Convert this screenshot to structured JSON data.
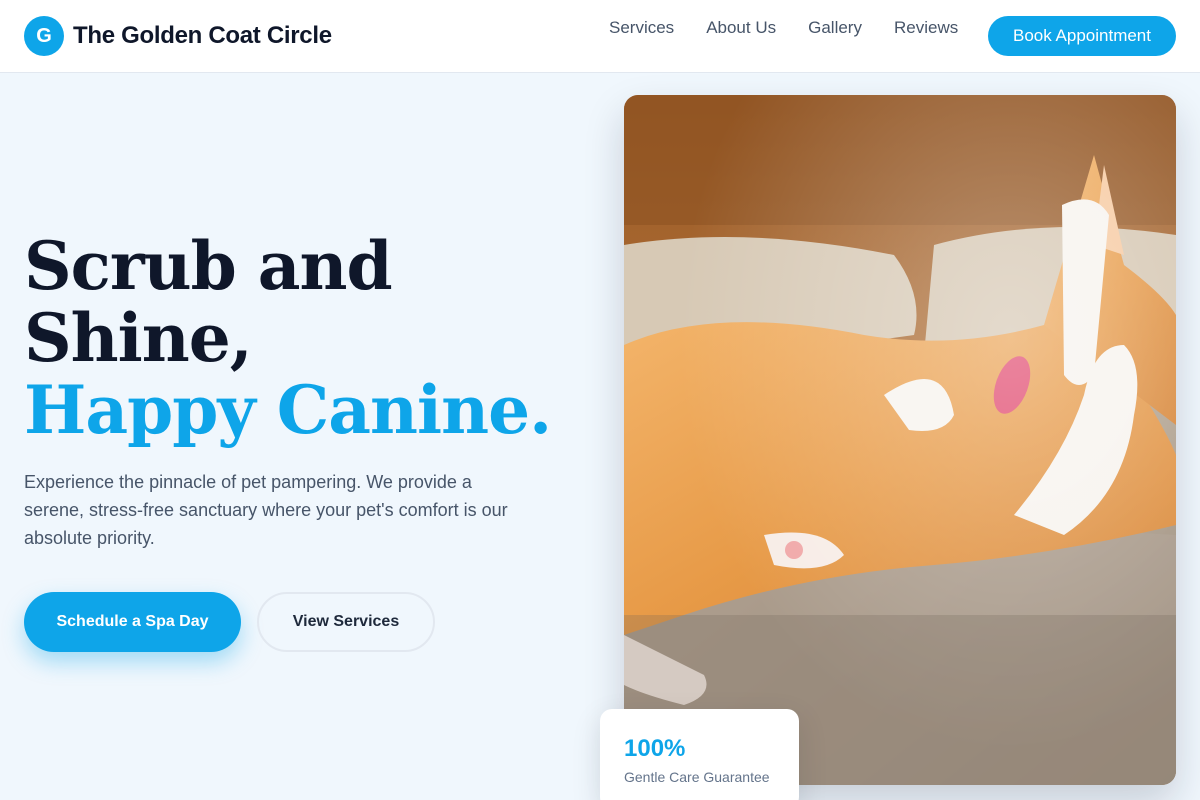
{
  "nav": {
    "logo_letter": "G",
    "brand_name": "The Golden Coat Circle",
    "links": [
      "Services",
      "About Us",
      "Gallery",
      "Reviews"
    ],
    "cta_label": "Book Appointment"
  },
  "hero": {
    "title_line1": "Scrub and",
    "title_line2": "Shine,",
    "title_accent": "Happy Canine.",
    "description": "Experience the pinnacle of pet pampering. We provide a serene, stress-free sanctuary where your pet's comfort is our absolute priority.",
    "primary_cta": "Schedule a Spa Day",
    "secondary_cta": "View Services"
  },
  "badge": {
    "value": "100%",
    "label": "Gentle Care Guarantee"
  },
  "colors": {
    "accent": "#0ea5e9",
    "heading": "#0f172a",
    "page_bg": "#f0f7fd"
  }
}
